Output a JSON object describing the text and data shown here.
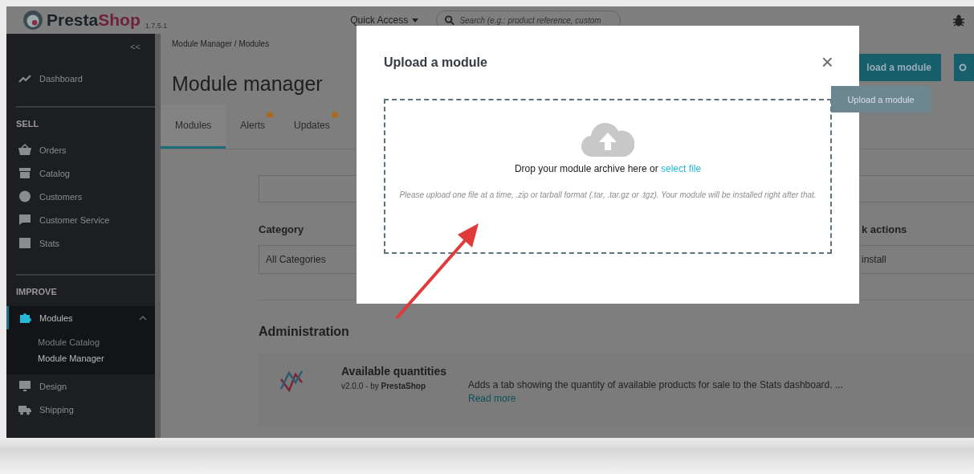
{
  "header": {
    "logo": {
      "first": "Presta",
      "second": "Shop"
    },
    "version": "1.7.5.1",
    "quick_access": "Quick Access",
    "search": {
      "placeholder": "Search (e.g.: product reference, custom"
    }
  },
  "sidebar": {
    "collapse": "<<",
    "top_items": [
      {
        "label": "Dashboard",
        "selected": false
      }
    ],
    "sections": [
      {
        "title": "SELL",
        "items": [
          {
            "label": "Orders",
            "selected": false,
            "expanded": false
          },
          {
            "label": "Catalog",
            "selected": false,
            "expanded": false
          },
          {
            "label": "Customers",
            "selected": false,
            "expanded": false
          },
          {
            "label": "Customer Service",
            "selected": false,
            "expanded": false
          },
          {
            "label": "Stats",
            "selected": false,
            "expanded": false
          }
        ]
      },
      {
        "title": "IMPROVE",
        "items": [
          {
            "label": "Modules",
            "selected": true,
            "expanded": true,
            "children": [
              {
                "label": "Module Catalog",
                "selected": false
              },
              {
                "label": "Module Manager",
                "selected": true
              }
            ]
          },
          {
            "label": "Design",
            "selected": false,
            "expanded": false
          },
          {
            "label": "Shipping",
            "selected": false,
            "expanded": false
          }
        ]
      }
    ]
  },
  "main": {
    "breadcrumb": "Module Manager /  Modules",
    "title": "Module manager",
    "header_button": "load a module",
    "tabs": [
      {
        "label": "Modules",
        "selected": true,
        "notification": false
      },
      {
        "label": "Alerts",
        "selected": false,
        "notification": true
      },
      {
        "label": "Updates",
        "selected": false,
        "notification": true
      }
    ],
    "category": {
      "label": "Category",
      "value": "All Categories"
    },
    "bulk": {
      "label": "k actions",
      "value": "install"
    },
    "section_title": "Administration",
    "modules": [
      {
        "name": "Available quantities",
        "meta": "v2.0.0 - by **PrestaShop**",
        "description": "Adds a tab showing the quantity of available products for sale to the Stats dashboard. ...",
        "link": "Read more"
      }
    ]
  },
  "modal": {
    "title": "Upload a module",
    "close": "×",
    "drop_text": "Drop your module archive here or ",
    "select_link": "select file",
    "hint": "Please upload one file at a time, .zip or tarball format (.tar, .tar.gz or .tgz). Your module will be installed right after that."
  },
  "tooltip": "Upload a module"
}
